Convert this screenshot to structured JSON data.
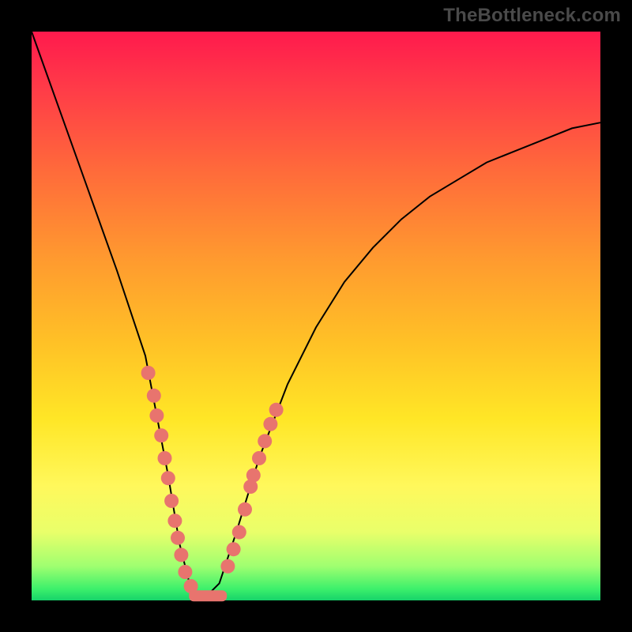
{
  "watermark": "TheBottleneck.com",
  "colors": {
    "accent_dot": "#e8746e",
    "curve": "#000000",
    "frame": "#000000"
  },
  "chart_data": {
    "type": "line",
    "title": "",
    "xlabel": "",
    "ylabel": "",
    "xlim": [
      0,
      100
    ],
    "ylim": [
      0,
      100
    ],
    "x": [
      0,
      5,
      10,
      15,
      20,
      24,
      26,
      28,
      30,
      33,
      36,
      40,
      45,
      50,
      55,
      60,
      65,
      70,
      75,
      80,
      85,
      90,
      95,
      100
    ],
    "y": [
      100,
      86,
      72,
      58,
      43,
      22,
      10,
      2,
      0,
      3,
      12,
      25,
      38,
      48,
      56,
      62,
      67,
      71,
      74,
      77,
      79,
      81,
      83,
      84
    ],
    "highlight_points": [
      {
        "x": 20.5,
        "y": 40
      },
      {
        "x": 21.5,
        "y": 36
      },
      {
        "x": 22.0,
        "y": 32.5
      },
      {
        "x": 22.8,
        "y": 29
      },
      {
        "x": 23.4,
        "y": 25
      },
      {
        "x": 24.0,
        "y": 21.5
      },
      {
        "x": 24.6,
        "y": 17.5
      },
      {
        "x": 25.2,
        "y": 14
      },
      {
        "x": 25.7,
        "y": 11
      },
      {
        "x": 26.3,
        "y": 8
      },
      {
        "x": 27.0,
        "y": 5
      },
      {
        "x": 28.0,
        "y": 2.5
      },
      {
        "x": 36.5,
        "y": 12
      },
      {
        "x": 37.5,
        "y": 16
      },
      {
        "x": 38.5,
        "y": 20
      },
      {
        "x": 39.0,
        "y": 22
      },
      {
        "x": 40.0,
        "y": 25
      },
      {
        "x": 41.0,
        "y": 28
      },
      {
        "x": 42.0,
        "y": 31
      },
      {
        "x": 43.0,
        "y": 33.5
      },
      {
        "x": 35.5,
        "y": 9
      },
      {
        "x": 34.5,
        "y": 6
      }
    ],
    "bottom_pill": {
      "x_start": 28.5,
      "x_end": 33.5,
      "y": 0.8
    }
  }
}
